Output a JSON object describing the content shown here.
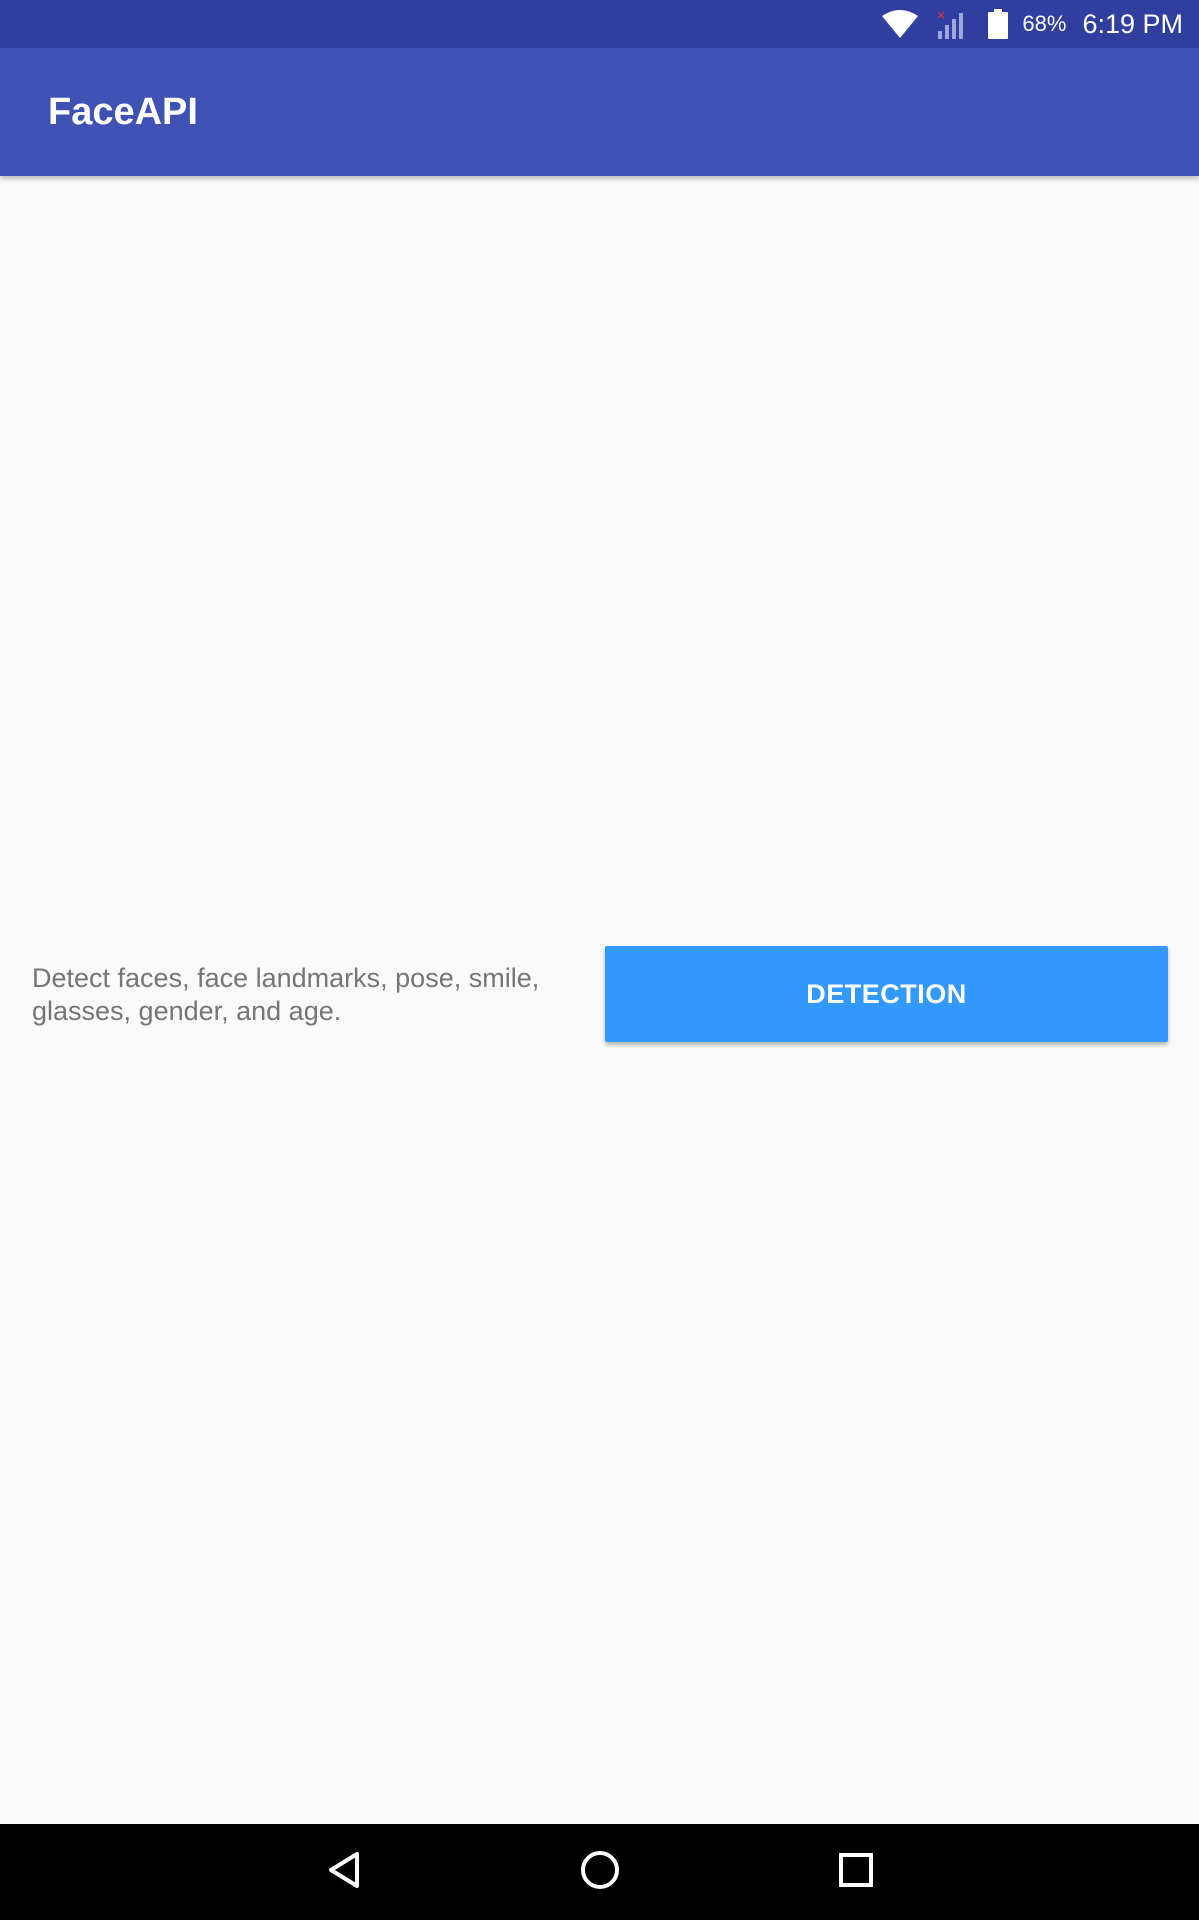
{
  "status_bar": {
    "battery_percent": "68%",
    "time": "6:19 PM",
    "icons": [
      "wifi-icon",
      "cell-signal-icon",
      "battery-icon"
    ]
  },
  "app_bar": {
    "title": "FaceAPI",
    "color": "#3f51b5",
    "status_color": "#303f9f"
  },
  "main": {
    "feature": {
      "description": "Detect faces, face landmarks, pose, smile, glasses, gender, and age.",
      "button_label": "DETECTION",
      "button_color": "#3399ff"
    }
  },
  "nav_bar": {
    "icons": [
      "back-icon",
      "home-icon",
      "recents-icon"
    ]
  }
}
